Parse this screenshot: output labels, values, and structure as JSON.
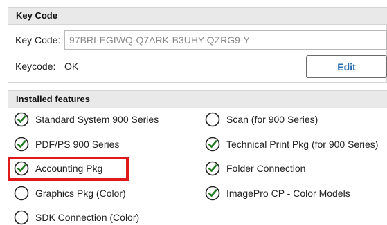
{
  "key_code_section": {
    "header": "Key Code",
    "key_code_label": "Key Code:",
    "key_code_value": "97BRI-EGIWQ-Q7ARK-B3UHY-QZRG9-Y",
    "status_label": "Keycode:",
    "status_value": "OK",
    "edit_button": "Edit"
  },
  "installed_features": {
    "header": "Installed features",
    "left_column": [
      {
        "label": "Standard System 900 Series",
        "installed": true
      },
      {
        "label": "PDF/PS 900 Series",
        "installed": true
      },
      {
        "label": "Accounting Pkg",
        "installed": true
      },
      {
        "label": "Graphics Pkg (Color)",
        "installed": false
      },
      {
        "label": "SDK Connection (Color)",
        "installed": false
      }
    ],
    "right_column": [
      {
        "label": "Scan (for 900 Series)",
        "installed": false
      },
      {
        "label": "Technical Print Pkg (for 900 Series)",
        "installed": true
      },
      {
        "label": "Folder Connection",
        "installed": true
      },
      {
        "label": "ImagePro CP - Color Models",
        "installed": true
      }
    ]
  },
  "highlighted_feature": "Accounting Pkg",
  "colors": {
    "highlight": "#e0191a",
    "check": "#1f7a1f",
    "edit_text": "#2a6fb3"
  }
}
